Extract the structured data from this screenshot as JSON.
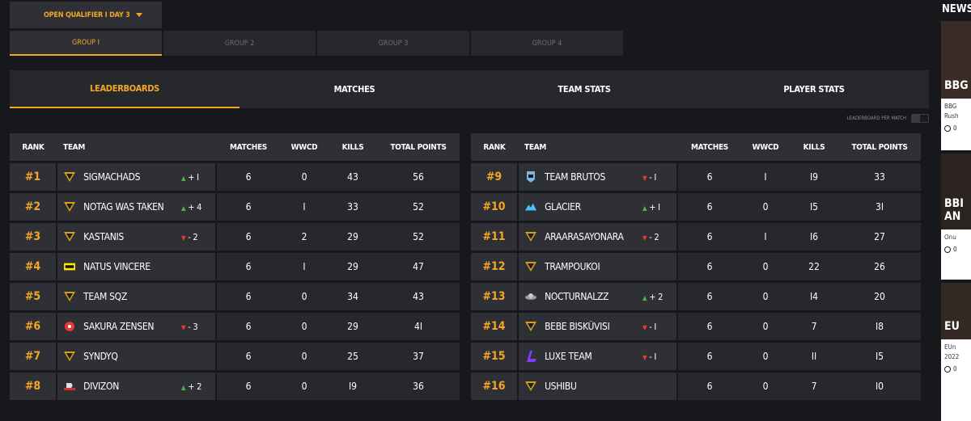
{
  "stage_selector": {
    "label": "OPEN QUALIFIER I DAY 3"
  },
  "groups": [
    {
      "label": "GROUP I",
      "active": true
    },
    {
      "label": "GROUP 2",
      "active": false
    },
    {
      "label": "GROUP 3",
      "active": false
    },
    {
      "label": "GROUP 4",
      "active": false
    }
  ],
  "tabs": [
    {
      "label": "LEADERBOARDS",
      "active": true
    },
    {
      "label": "MATCHES",
      "active": false
    },
    {
      "label": "TEAM STATS",
      "active": false
    },
    {
      "label": "PLAYER STATS",
      "active": false
    }
  ],
  "leaderboard_per_match": {
    "label": "LEADERBOARD PER MATCH"
  },
  "columns": {
    "rank": "RANK",
    "team": "TEAM",
    "matches": "MATCHES",
    "wwcd": "WWCD",
    "kills": "KILLS",
    "total": "TOTAL POINTS"
  },
  "left_board": [
    {
      "rank": "#1",
      "team": "SIGMACHADS",
      "dir": "up",
      "change": "+ I",
      "matches": "6",
      "wwcd": "0",
      "kills": "43",
      "points": "56",
      "logo": "shield-logo",
      "logo_color": "#d4a017"
    },
    {
      "rank": "#2",
      "team": "NOTAG WAS TAKEN",
      "dir": "up",
      "change": "+ 4",
      "matches": "6",
      "wwcd": "I",
      "kills": "33",
      "points": "52",
      "logo": "shield-logo",
      "logo_color": "#d4a017"
    },
    {
      "rank": "#3",
      "team": "KASTANIS",
      "dir": "down",
      "change": "- 2",
      "matches": "6",
      "wwcd": "2",
      "kills": "29",
      "points": "52",
      "logo": "shield-logo",
      "logo_color": "#d4a017"
    },
    {
      "rank": "#4",
      "team": "NATUS VINCERE",
      "dir": "",
      "change": "",
      "matches": "6",
      "wwcd": "I",
      "kills": "29",
      "points": "47",
      "logo": "navi-logo",
      "logo_color": "#ffe600"
    },
    {
      "rank": "#5",
      "team": "TEAM SQZ",
      "dir": "",
      "change": "",
      "matches": "6",
      "wwcd": "0",
      "kills": "34",
      "points": "43",
      "logo": "shield-logo",
      "logo_color": "#d4a017"
    },
    {
      "rank": "#6",
      "team": "SAKURA ZENSEN",
      "dir": "down",
      "change": "- 3",
      "matches": "6",
      "wwcd": "0",
      "kills": "29",
      "points": "4I",
      "logo": "sakura-logo",
      "logo_color": "#e53935"
    },
    {
      "rank": "#7",
      "team": "SYNDYQ",
      "dir": "",
      "change": "",
      "matches": "6",
      "wwcd": "0",
      "kills": "25",
      "points": "37",
      "logo": "shield-logo",
      "logo_color": "#d4a017"
    },
    {
      "rank": "#8",
      "team": "DIVIZON",
      "dir": "up",
      "change": "+ 2",
      "matches": "6",
      "wwcd": "0",
      "kills": "I9",
      "points": "36",
      "logo": "divizon-logo",
      "logo_color": "#e0e0e0"
    }
  ],
  "right_board": [
    {
      "rank": "#9",
      "team": "TEAM BRUTOS",
      "dir": "down",
      "change": "- I",
      "matches": "6",
      "wwcd": "I",
      "kills": "I9",
      "points": "33",
      "logo": "brutos-logo",
      "logo_color": "#7ab8d9"
    },
    {
      "rank": "#10",
      "team": "GLACIER",
      "dir": "up",
      "change": "+ I",
      "matches": "6",
      "wwcd": "0",
      "kills": "I5",
      "points": "3I",
      "logo": "glacier-logo",
      "logo_color": "#4fc3f7"
    },
    {
      "rank": "#11",
      "team": "ARAARASAYONARA",
      "dir": "down",
      "change": "- 2",
      "matches": "6",
      "wwcd": "I",
      "kills": "I6",
      "points": "27",
      "logo": "shield-logo",
      "logo_color": "#d4a017"
    },
    {
      "rank": "#12",
      "team": "TRAMPOUKOI",
      "dir": "",
      "change": "",
      "matches": "6",
      "wwcd": "0",
      "kills": "22",
      "points": "26",
      "logo": "shield-logo",
      "logo_color": "#d4a017"
    },
    {
      "rank": "#13",
      "team": "NOCTURNALZZ",
      "dir": "up",
      "change": "+ 2",
      "matches": "6",
      "wwcd": "0",
      "kills": "I4",
      "points": "20",
      "logo": "nocturnalzz-logo",
      "logo_color": "#9e9e9e"
    },
    {
      "rank": "#14",
      "team": "BEBE BISKÜVISI",
      "dir": "down",
      "change": "- I",
      "matches": "6",
      "wwcd": "0",
      "kills": "7",
      "points": "I8",
      "logo": "shield-logo",
      "logo_color": "#d4a017"
    },
    {
      "rank": "#15",
      "team": "LUXE TEAM",
      "dir": "down",
      "change": "- I",
      "matches": "6",
      "wwcd": "0",
      "kills": "II",
      "points": "I5",
      "logo": "luxe-logo",
      "logo_color": "#7e3ff2"
    },
    {
      "rank": "#16",
      "team": "USHIBU",
      "dir": "",
      "change": "",
      "matches": "6",
      "wwcd": "0",
      "kills": "7",
      "points": "I0",
      "logo": "shield-logo",
      "logo_color": "#d4a017"
    }
  ],
  "news": {
    "header": "NEWS",
    "cards": [
      {
        "title": "BBG",
        "snippet": "BBG Rush",
        "comments": "0"
      },
      {
        "title": "BBI AN",
        "snippet": "Onu",
        "comments": "0"
      },
      {
        "title": "EU",
        "snippet": "EUn 2022",
        "comments": "0"
      }
    ]
  }
}
